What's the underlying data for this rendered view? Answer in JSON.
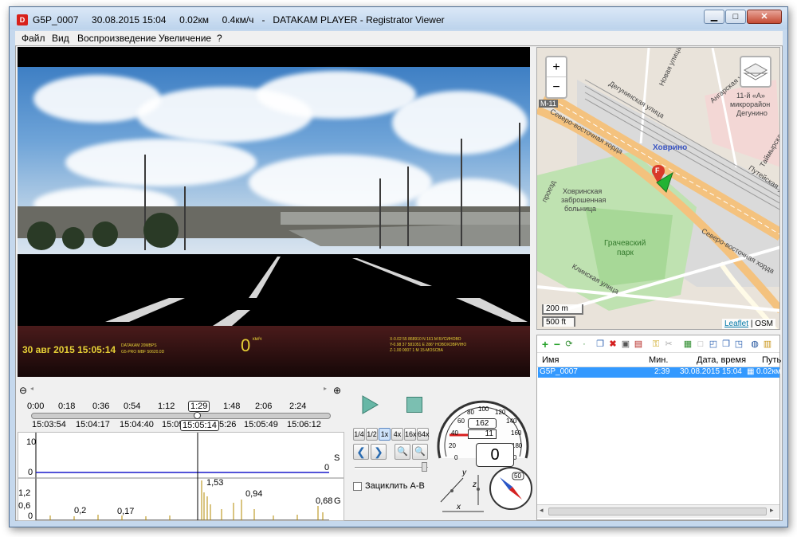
{
  "window": {
    "title": "G5P_0007     30.08.2015 15:04     0.02км     0.4км/ч   -   DATAKAM PLAYER - Registrator Viewer",
    "app_icon": "D",
    "buttons": {
      "minimize": "▁",
      "maximize": "□",
      "close": "✕"
    }
  },
  "menu": [
    "Файл",
    "Вид",
    "Воспроизведение",
    "Увеличение",
    "?"
  ],
  "video": {
    "date": "30 авг 2015 15:05:14",
    "speed": "0",
    "speed_unit": "км/ч",
    "info_a": "DATAKAM        20MBPS",
    "info_b": "G5-PRO MBF 50620.0D",
    "info_c": "X-0.02    55 868910 N   161 M  БУСИНОВО",
    "info_d": "Y-0.98    37 581051 E   286°  НОВОХОВРИНО",
    "info_e": "Z-1.00       0007    1 M   15-MOSCBA"
  },
  "timeline": {
    "times": [
      "0:00",
      "0:18",
      "0:36",
      "0:54",
      "1:12",
      "1:29",
      "1:48",
      "2:06",
      "2:24"
    ],
    "clock": [
      "15:03:54",
      "15:04:17",
      "15:04:40",
      "15:05",
      "15:05:14",
      "5:26",
      "15:05:49",
      "15:06:12"
    ],
    "zoom_out_icon": "zoom-out-icon",
    "zoom_in_icon": "zoom-in-icon"
  },
  "graphs": {
    "speed": {
      "y_max": "10",
      "y_min": "0",
      "label": "S",
      "value": "0"
    },
    "g": {
      "ticks": [
        "1,2",
        "0,6",
        "0"
      ],
      "label": "G",
      "annotations": [
        "0,2",
        "0,17",
        "1,53",
        "0,94",
        "0,68"
      ]
    }
  },
  "controls": {
    "speeds": [
      "1/4",
      "1/2",
      "1x",
      "4x",
      "16x",
      "64x"
    ],
    "active_speed": "1x",
    "loop_label": "Зациклить A-B"
  },
  "gauge": {
    "scale": [
      "0",
      "20",
      "40",
      "60",
      "80",
      "100",
      "120",
      "140",
      "160",
      "180",
      "200"
    ],
    "odometer_top": "162",
    "odometer_bottom": "11",
    "speed": "0"
  },
  "accel": {
    "axes": [
      "y",
      "x",
      "z"
    ]
  },
  "compass": {
    "heading": "50"
  },
  "map": {
    "zoom_in": "+",
    "zoom_out": "−",
    "labels": [
      "Новая улица",
      "Дегунинская улица",
      "Ангарская улица",
      "11-й «А»",
      "микрорайон",
      "Дегунино",
      "Таймырская улица",
      "Северо-восточная хорда",
      "Ховрино",
      "Путейская улица",
      "проезд",
      "Ховринская",
      "заброшенная",
      "больница",
      "Грачевский",
      "парк",
      "Клинская улица",
      "Северо-восточная хорда",
      "М-11"
    ],
    "marker": "F",
    "scale_m": "200 m",
    "scale_ft": "500 ft",
    "attribution_link": "Leaflet",
    "attribution_rest": "| OSM"
  },
  "file_list": {
    "headers": [
      "Имя",
      "Мин.",
      "Дата, время",
      "Путь"
    ],
    "rows": [
      {
        "name": "G5P_0007",
        "min": "2:39",
        "datetime": "30.08.2015 15:04",
        "path": "0.02км"
      }
    ]
  }
}
